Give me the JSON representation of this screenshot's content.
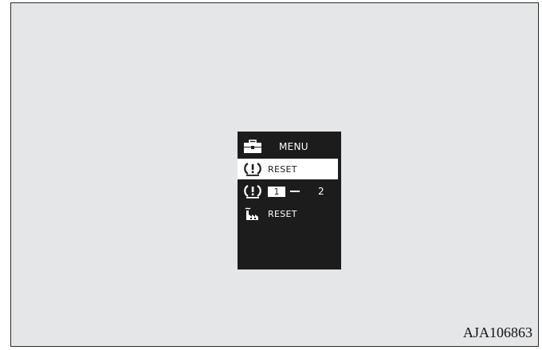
{
  "display": {
    "header": {
      "icon": "toolbox-icon",
      "label": "MENU"
    },
    "items": [
      {
        "icon": "tire-pressure-warning-icon",
        "label": "RESET",
        "selected": true
      },
      {
        "icon": "tire-pressure-warning-icon",
        "selected_value": "1",
        "separator": "–",
        "other_value": "2"
      },
      {
        "icon": "factory-icon",
        "label": "RESET"
      }
    ]
  },
  "caption": "AJA106863",
  "colors": {
    "background": "#e5e6e8",
    "screen": "#1c1c1c",
    "highlight": "#ffffff"
  }
}
